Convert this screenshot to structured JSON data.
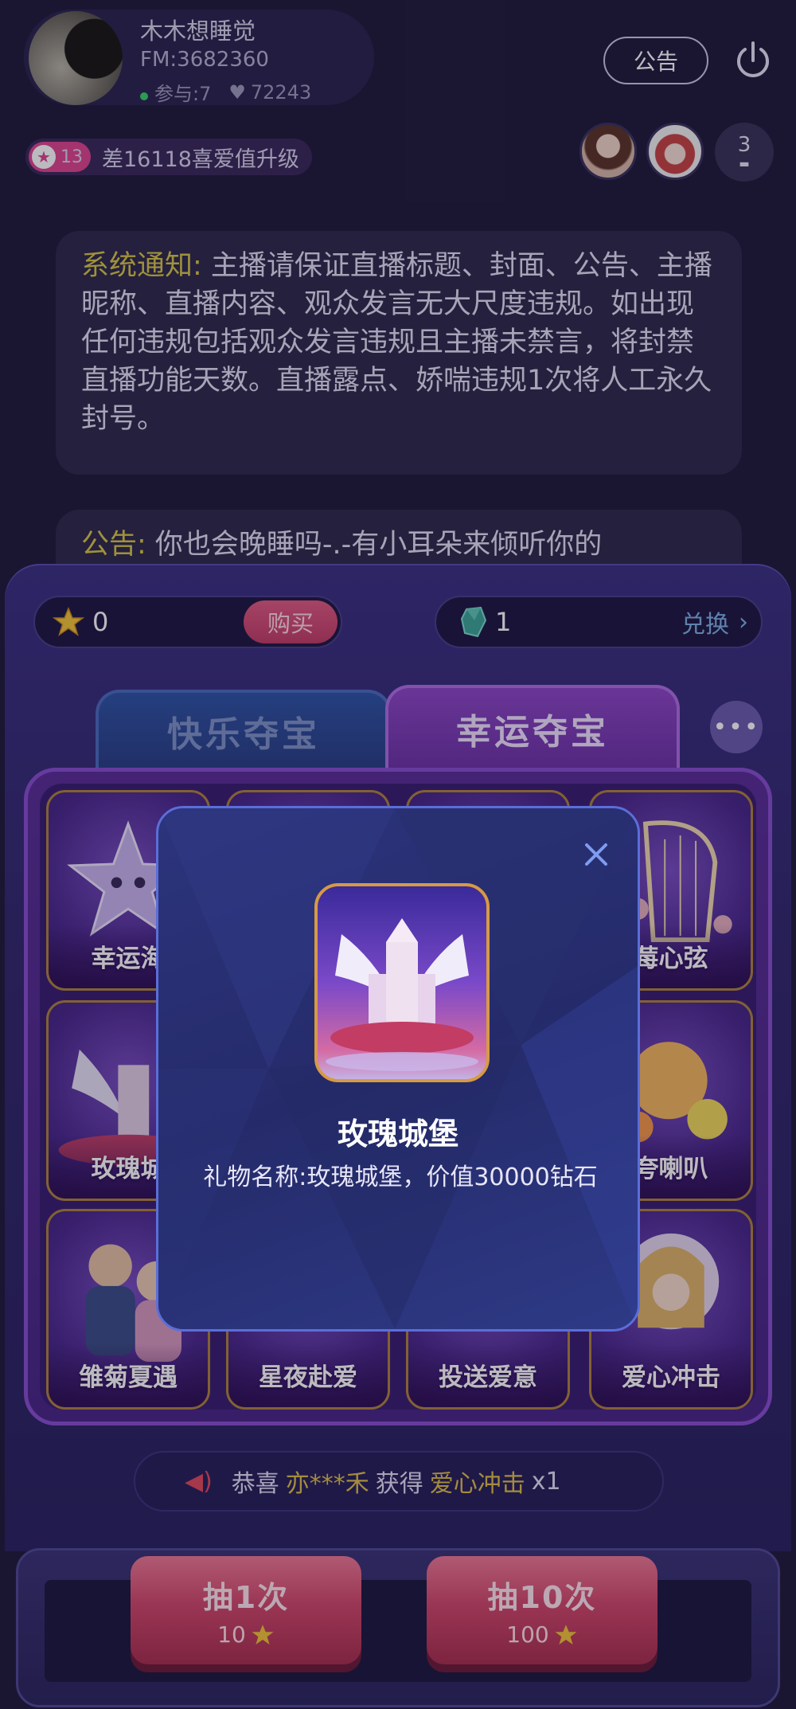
{
  "host": {
    "name": "木木想睡觉",
    "fm": "FM:3682360",
    "participants": "参与:7",
    "likes": "72243"
  },
  "header": {
    "notice_button": "公告",
    "level": "13",
    "level_text": "差16118喜爱值升级",
    "viewer_count": "3"
  },
  "messages": [
    {
      "tag": "系统通知:",
      "text": " 主播请保证直播标题、封面、公告、主播昵称、直播内容、观众发言无大尺度违规。如出现任何违规包括观众发言违规且主播未禁言，将封禁直播功能天数。直播露点、娇喘违规1次将人工永久封号。"
    },
    {
      "tag": "公告:",
      "text": " 你也会晚睡吗-.-有小耳朵来倾听你的"
    }
  ],
  "currency": {
    "stars": "0",
    "buy_label": "购买",
    "gems": "1",
    "exchange_label": "兑换"
  },
  "tabs": {
    "happy": "快乐夺宝",
    "lucky": "幸运夺宝"
  },
  "prizes": [
    {
      "label": "幸运海"
    },
    {
      "label": ""
    },
    {
      "label": ""
    },
    {
      "label": "莓心弦"
    },
    {
      "label": "玫瑰城"
    },
    {
      "label": "夸喇叭"
    },
    {
      "label": "雏菊夏遇"
    },
    {
      "label": "星夜赴爱"
    },
    {
      "label": "投送爱意"
    },
    {
      "label": "爱心冲击"
    }
  ],
  "broadcast": {
    "prefix": "恭喜",
    "user": "亦***禾",
    "verb": "获得",
    "item": "爱心冲击",
    "qty": "x1"
  },
  "draw": {
    "once_label": "抽1次",
    "once_cost": "10",
    "ten_label": "抽10次",
    "ten_cost": "100"
  },
  "modal": {
    "gift_name": "玫瑰城堡",
    "gift_desc": "礼物名称:玫瑰城堡，价值30000钻石"
  },
  "colors": {
    "accent_gold": "#e0c04d",
    "draw_button": "#d2486c",
    "tab_active": "#8f48c8",
    "tab_inactive": "#2f55a6"
  }
}
